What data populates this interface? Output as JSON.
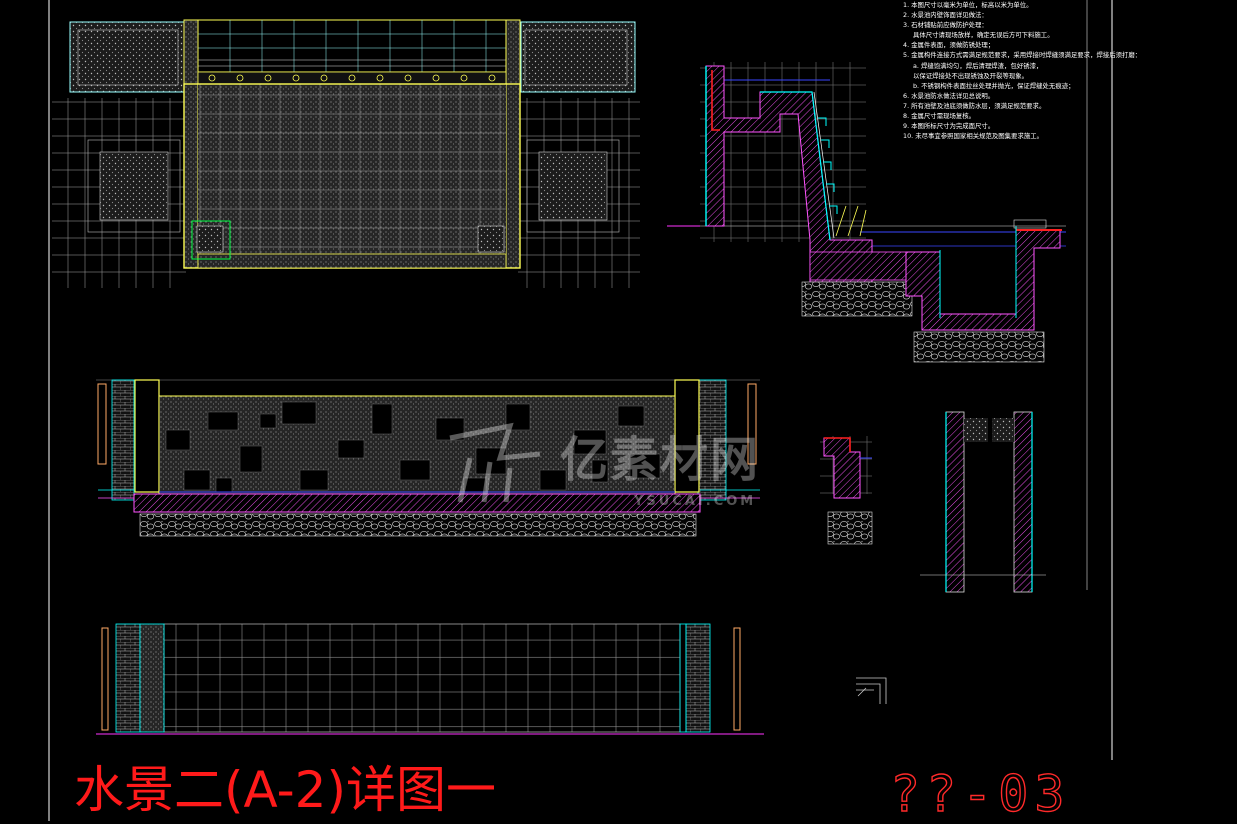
{
  "drawing": {
    "title": "水景二(A-2)详图一",
    "sheet_number": "??-03",
    "title_color": "#ff1a1a"
  },
  "notes": [
    "1. 本图尺寸以毫米为单位，标高以米为单位。",
    "2. 水景池内壁饰面详见做法：",
    "3. 石材铺贴前应做防护处理：",
    "   具体尺寸请现场放样，确定无误后方可下料施工。",
    "4. 金属件表面，须做防锈处理；",
    "5. 金属构件连接方式需满足规范要求，采用焊接时焊缝须满足要求，焊接后须打磨：",
    "   a. 焊缝饱满均匀，焊后清理焊渣，包好锈漆，",
    "      以保证焊接处不出现锈蚀及开裂等现象。",
    "   b. 不锈钢构件表面拉丝处理并抛光，保证焊缝处无痕迹；",
    "6. 水景池防水做法详见总说明。",
    "7. 所有池壁及池底须做防水层，须满足规范要求。",
    "8. 金属尺寸需现场复核。",
    "9. 本图所标尺寸为完成面尺寸。",
    "10. 未尽事宜参照国家相关规范及图集要求施工。"
  ],
  "watermark": {
    "brand": "亿素材网",
    "domain_text": "YSUCAI.COM"
  },
  "colors": {
    "background": "#000000",
    "frame": "#ffffff",
    "outline_yellow": "#ffff33",
    "section_cyan": "#00ffff",
    "finish_magenta": "#ff33ff",
    "highlight_red": "#ff2020",
    "grid_gray": "#9a9a9a",
    "water_blue": "#3a46ff",
    "marker_green": "#00ff44"
  },
  "icons": [
    "watermark-logo-icon",
    "section-marker-icon"
  ]
}
